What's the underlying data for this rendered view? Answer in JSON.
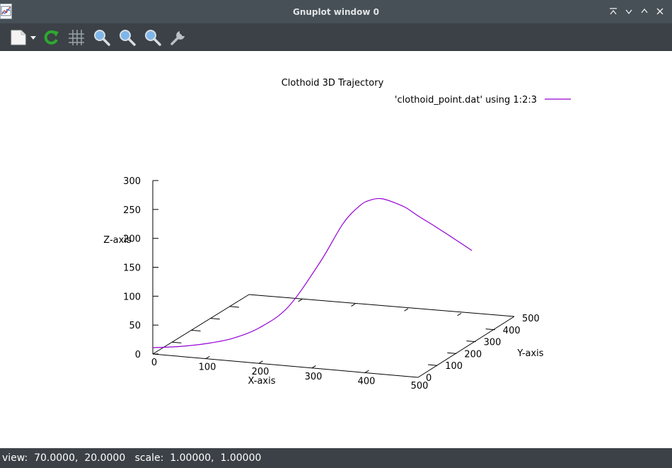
{
  "window": {
    "title": "Gnuplot window 0",
    "controls": [
      "minimize",
      "restore",
      "maximize",
      "close"
    ]
  },
  "toolbar": {
    "buttons": [
      {
        "name": "export-button",
        "icon": "document-export-icon"
      },
      {
        "name": "replot-button",
        "icon": "refresh-icon"
      },
      {
        "name": "grid-button",
        "icon": "grid-icon"
      },
      {
        "name": "previous-zoom-button",
        "icon": "zoom-previous-icon"
      },
      {
        "name": "next-zoom-button",
        "icon": "zoom-next-icon"
      },
      {
        "name": "autoscale-button",
        "icon": "zoom-autoscale-icon"
      },
      {
        "name": "config-button",
        "icon": "wrench-icon"
      }
    ]
  },
  "chart_data": {
    "type": "line",
    "title": "Clothoid 3D Trajectory",
    "xlabel": "X-axis",
    "ylabel": "Y-axis",
    "zlabel": "Z-axis",
    "legend": {
      "entry": "'clothoid_point.dat' using 1:2:3",
      "position": "top-right"
    },
    "xlim": [
      0,
      500
    ],
    "ylim": [
      0,
      500
    ],
    "zlim": [
      0,
      300
    ],
    "x_ticks": [
      "0",
      "100",
      "200",
      "300",
      "400",
      "500"
    ],
    "y_ticks": [
      "0",
      "100",
      "200",
      "300",
      "400",
      "500"
    ],
    "z_ticks": [
      "0",
      "50",
      "100",
      "150",
      "200",
      "250",
      "300"
    ],
    "view": {
      "rot_x": 70,
      "rot_z": 20
    },
    "series_color": "#9400d3",
    "series": [
      {
        "points": [
          [
            0,
            0,
            11
          ],
          [
            50,
            0,
            17
          ],
          [
            100,
            0,
            26
          ],
          [
            150,
            1,
            39
          ],
          [
            200,
            5,
            61
          ],
          [
            250,
            16,
            99
          ],
          [
            300,
            44,
            175
          ],
          [
            330,
            79,
            236
          ],
          [
            350,
            111,
            262
          ],
          [
            360,
            137,
            267
          ],
          [
            370,
            168,
            264
          ],
          [
            380,
            201,
            252
          ],
          [
            390,
            238,
            236
          ],
          [
            400,
            277,
            214
          ],
          [
            420,
            314,
            189
          ],
          [
            441,
            350,
            163
          ],
          [
            462,
            385,
            137
          ]
        ]
      }
    ]
  },
  "statusbar": {
    "text": "view:  70.0000,  20.0000   scale:  1.00000,  1.00000"
  }
}
